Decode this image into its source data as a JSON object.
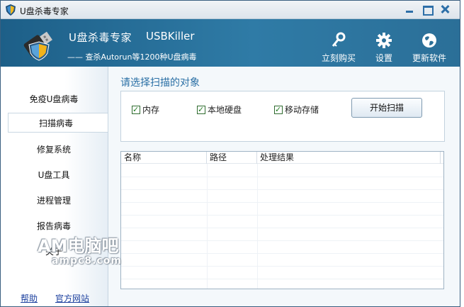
{
  "window": {
    "title": "U盘杀毒专家",
    "controls": [
      "minimize",
      "maximize",
      "close"
    ]
  },
  "header": {
    "app_name": "U盘杀毒专家",
    "app_name_en": "USBKiller",
    "subtitle": "—— 查杀Autorun等1200种U盘病毒",
    "buttons": [
      {
        "label": "立刻购买",
        "icon": "key-icon"
      },
      {
        "label": "设置",
        "icon": "gear-icon"
      },
      {
        "label": "更新软件",
        "icon": "globe-icon"
      }
    ]
  },
  "sidebar": {
    "items": [
      {
        "label": "免疫U盘病毒",
        "active": false
      },
      {
        "label": "扫描病毒",
        "active": true
      },
      {
        "label": "修复系统",
        "active": false
      },
      {
        "label": "U盘工具",
        "active": false
      },
      {
        "label": "进程管理",
        "active": false
      },
      {
        "label": "报告病毒",
        "active": false
      },
      {
        "label": "关于",
        "active": false
      }
    ],
    "links": {
      "help": "帮助",
      "website": "官方网站"
    }
  },
  "main": {
    "section_title": "请选择扫描的对象",
    "options": [
      {
        "label": "内存",
        "checked": true
      },
      {
        "label": "本地硬盘",
        "checked": true
      },
      {
        "label": "移动存储",
        "checked": true
      }
    ],
    "scan_button": "开始扫描",
    "results": {
      "columns": [
        "名称",
        "路径",
        "处理结果"
      ],
      "rows": []
    }
  },
  "watermark": {
    "line1": "AM电脑吧",
    "line2": "ampc8.com"
  },
  "colors": {
    "header_bg": "#2a6f98",
    "accent_title": "#2a6fa5",
    "link": "#1b3f9e"
  }
}
